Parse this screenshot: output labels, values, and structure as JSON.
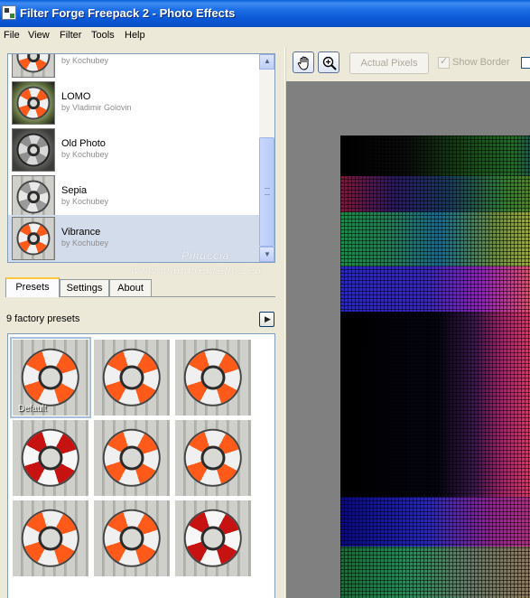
{
  "window": {
    "title": "Filter Forge Freepack 2 - Photo Effects"
  },
  "menu": [
    "File",
    "View",
    "Filter",
    "Tools",
    "Help"
  ],
  "filters": [
    {
      "name": "",
      "author": "by Kochubey",
      "style": "color"
    },
    {
      "name": "LOMO",
      "author": "by Vladimir Golovin",
      "style": "lomo"
    },
    {
      "name": "Old Photo",
      "author": "by Kochubey",
      "style": "old"
    },
    {
      "name": "Sepia",
      "author": "by Kochubey",
      "style": "gray"
    },
    {
      "name": "Vibrance",
      "author": "by Kochubey",
      "style": "color",
      "selected": true
    }
  ],
  "tabs": [
    {
      "label": "Presets",
      "active": true
    },
    {
      "label": "Settings",
      "active": false
    },
    {
      "label": "About",
      "active": false
    }
  ],
  "presets": {
    "count_text": "9 factory presets",
    "items": [
      {
        "label": "Default",
        "variant": "orange",
        "selected": true
      },
      {
        "label": "",
        "variant": "orange"
      },
      {
        "label": "",
        "variant": "orange"
      },
      {
        "label": "",
        "variant": "dark"
      },
      {
        "label": "",
        "variant": "orange"
      },
      {
        "label": "",
        "variant": "orange"
      },
      {
        "label": "",
        "variant": "orange"
      },
      {
        "label": "",
        "variant": "orange"
      },
      {
        "label": "",
        "variant": "dark"
      }
    ]
  },
  "toolbar": {
    "hand_tool": "hand-icon",
    "zoom_tool": "zoom-icon",
    "actual_pixels_label": "Actual Pixels",
    "show_border_label": "Show Border",
    "show_border_checked": true
  },
  "watermark": {
    "line1": "Pinuccia",
    "line2": "www.maddiregrafics.eu"
  },
  "colors": {
    "titlebar": "#0A58D6",
    "selection": "#D3DCEB",
    "active_tab_accent": "#FFC73C",
    "preview_bg": "#808080"
  }
}
